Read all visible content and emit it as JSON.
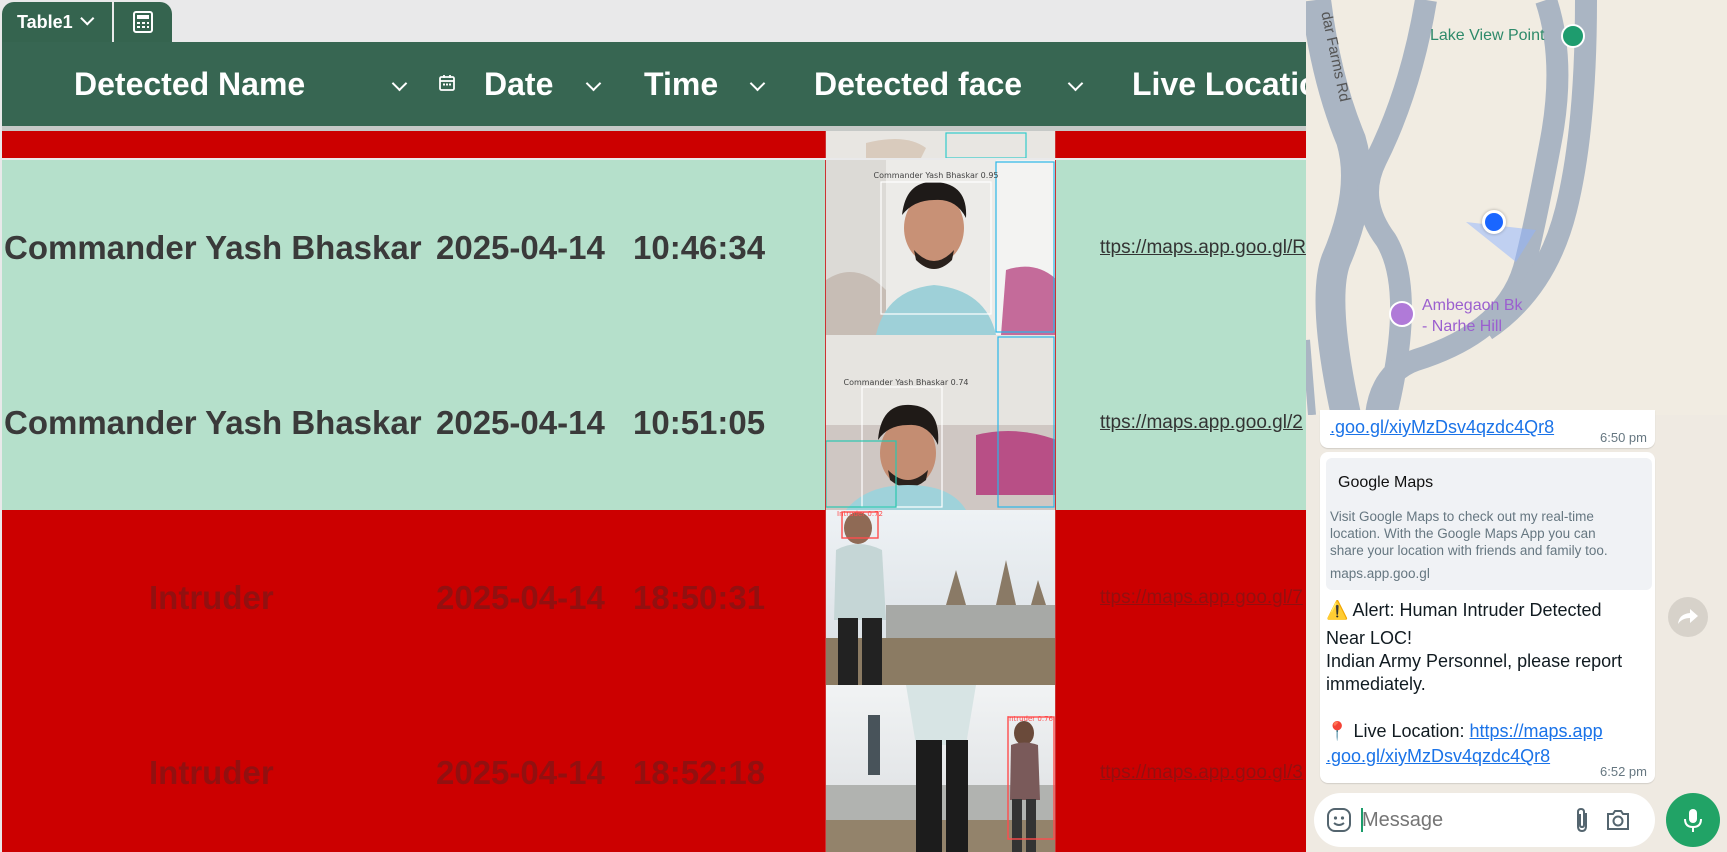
{
  "table_app": {
    "tab_name": "Table1",
    "columns": [
      {
        "label": "Detected Name"
      },
      {
        "label": "Date"
      },
      {
        "label": "Time"
      },
      {
        "label": "Detected face"
      },
      {
        "label": "Live Locatio"
      }
    ],
    "rows": [
      {
        "name": "Commander Yash Bhaskar",
        "date": "2025-04-14",
        "time": "10:46:34",
        "location": "ttps://maps.app.goo.gl/R",
        "status": "known",
        "face_tags": [
          "Commander Yash Bhaskar 0.95"
        ]
      },
      {
        "name": "Commander Yash Bhaskar",
        "date": "2025-04-14",
        "time": "10:51:05",
        "location": "ttps://maps.app.goo.gl/2",
        "status": "known",
        "face_tags": [
          "Commander Yash Bhaskar 0.74"
        ]
      },
      {
        "name": "Intruder",
        "date": "2025-04-14",
        "time": "18:50:31",
        "location": "ttps://maps.app.goo.gl/7",
        "status": "intruder",
        "face_tags": [
          "Intruder 0.72"
        ]
      },
      {
        "name": "Intruder",
        "date": "2025-04-14",
        "time": "18:52:18",
        "location": "ttps://maps.app.goo.gl/3",
        "status": "intruder",
        "face_tags": [
          "Intruder 0.76"
        ]
      }
    ],
    "colors": {
      "header": "#376652",
      "known_row": "#b5e0cb",
      "intruder_row": "#cc0000"
    }
  },
  "chat_app": {
    "map": {
      "road_label": "dar Farms Rd",
      "poi_1": "Lake View Point",
      "poi_2_line1": "Ambegaon Bk",
      "poi_2_line2": "- Narhe Hill"
    },
    "messages": [
      {
        "link_tail": ".goo.gl/xiyMzDsv4qzdc4Qr8",
        "time": "6:50 pm"
      },
      {
        "preview_title": "Google Maps",
        "preview_desc_1": "Visit Google Maps to check out my real-time",
        "preview_desc_2": "location. With the Google Maps App you can",
        "preview_desc_3": "share your location with friends and family too.",
        "preview_domain": "maps.app.goo.gl",
        "alert_icon": "⚠️",
        "alert_line1": "Alert: Human Intruder Detected",
        "alert_line2": "Near LOC!",
        "alert_line3": "Indian Army Personnel, please report",
        "alert_line4": "immediately.",
        "pin_icon": "📍",
        "location_label": "Live Location: ",
        "location_link_1": "https://maps.app",
        "location_link_2": ".goo.gl/xiyMzDsv4qzdc4Qr8",
        "time": "6:52 pm"
      }
    ],
    "input_placeholder": "Message",
    "icons": [
      "emoji-icon",
      "attach-icon",
      "camera-icon",
      "mic-icon",
      "forward-icon",
      "location-dot-icon"
    ]
  }
}
